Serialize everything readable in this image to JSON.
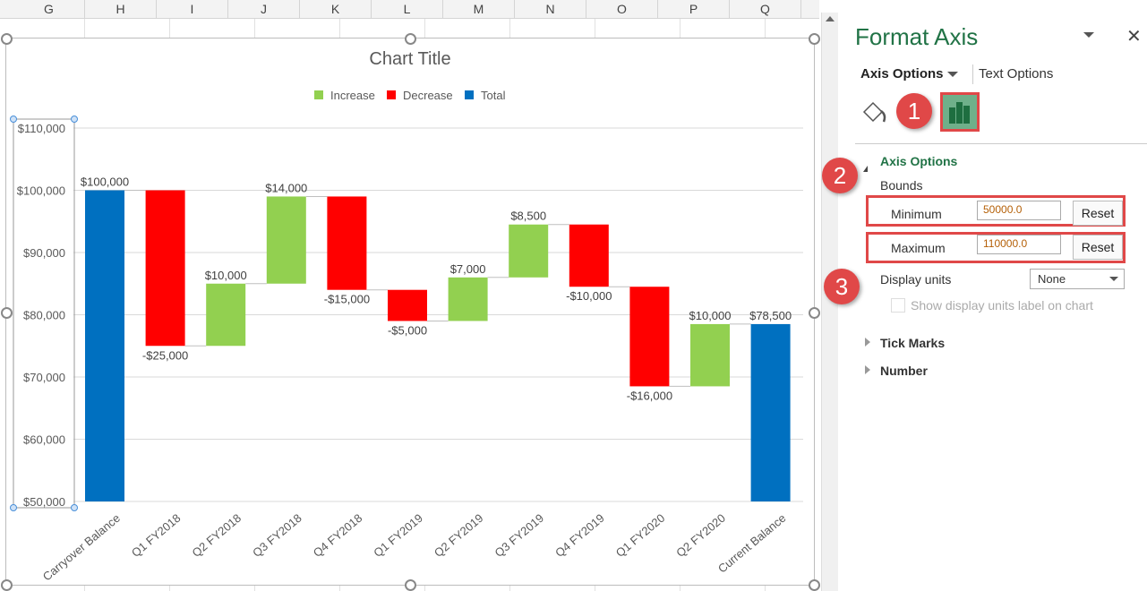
{
  "columns": [
    "G",
    "H",
    "I",
    "J",
    "K",
    "L",
    "M",
    "N",
    "O",
    "P",
    "Q"
  ],
  "pane": {
    "title": "Format Axis",
    "tab_axis_options": "Axis Options",
    "tab_text_options": "Text Options",
    "section_axis_options": "Axis Options",
    "bounds_label": "Bounds",
    "minimum_label": "Minimum",
    "minimum_value": "50000.0",
    "maximum_label": "Maximum",
    "maximum_value": "110000.0",
    "reset_label": "Reset",
    "display_units_label": "Display units",
    "display_units_value": "None",
    "show_units_label": "Show display units label on chart",
    "tick_marks": "Tick Marks",
    "number": "Number",
    "badges": [
      "1",
      "2",
      "3"
    ],
    "accent": "#217346",
    "callout_color": "#e04848"
  },
  "chart_data": {
    "type": "waterfall",
    "title": "Chart Title",
    "legend": [
      "Increase",
      "Decrease",
      "Total"
    ],
    "legend_position": "top",
    "colors": {
      "Increase": "#92d050",
      "Decrease": "#ff0000",
      "Total": "#0070c0"
    },
    "categories": [
      "Carryover Balance",
      "Q1 FY2018",
      "Q2 FY2018",
      "Q3 FY2018",
      "Q4 FY2018",
      "Q1 FY2019",
      "Q2 FY2019",
      "Q3 FY2019",
      "Q4 FY2019",
      "Q1 FY2020",
      "Q2 FY2020",
      "Current Balance"
    ],
    "values": [
      100000,
      -25000,
      10000,
      14000,
      -15000,
      -5000,
      7000,
      8500,
      -10000,
      -16000,
      10000,
      78500
    ],
    "kinds": [
      "Total",
      "Decrease",
      "Increase",
      "Increase",
      "Decrease",
      "Decrease",
      "Increase",
      "Increase",
      "Decrease",
      "Decrease",
      "Increase",
      "Total"
    ],
    "labels": [
      "$100,000",
      "-$25,000",
      "$10,000",
      "$14,000",
      "-$15,000",
      "-$5,000",
      "$7,000",
      "$8,500",
      "-$10,000",
      "-$16,000",
      "$10,000",
      "$78,500"
    ],
    "ylim": [
      50000,
      110000
    ],
    "yticks": [
      50000,
      60000,
      70000,
      80000,
      90000,
      100000,
      110000
    ],
    "ytick_labels": [
      "$50,000",
      "$60,000",
      "$70,000",
      "$80,000",
      "$90,000",
      "$100,000",
      "$110,000"
    ],
    "grid": true
  }
}
